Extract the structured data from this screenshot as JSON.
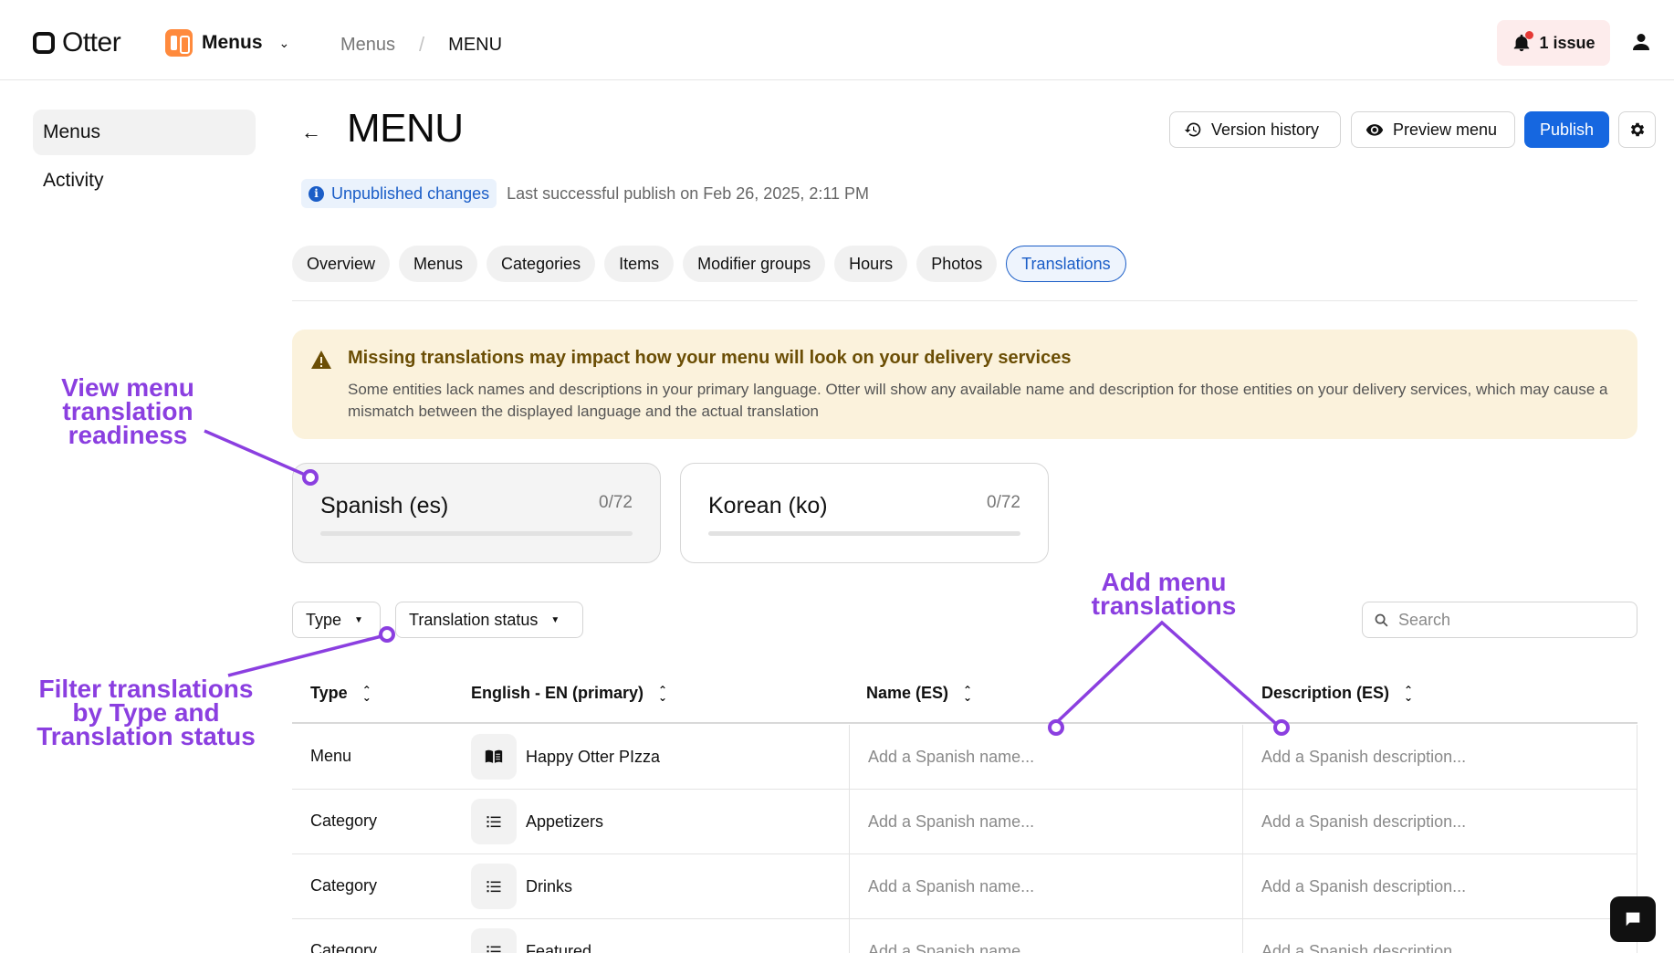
{
  "topbar": {
    "logo_text": "Otter",
    "app_name": "Menus",
    "breadcrumbs": [
      "Menus",
      "MENU"
    ],
    "breadcrumb_separator": "/",
    "issue_label": "1 issue"
  },
  "sidebar": {
    "items": [
      {
        "label": "Menus",
        "active": true
      },
      {
        "label": "Activity",
        "active": false
      }
    ]
  },
  "header": {
    "title": "MENU",
    "version_history_label": "Version history",
    "preview_label": "Preview menu",
    "publish_label": "Publish",
    "status_badge": "Unpublished changes",
    "status_text": "Last successful publish on Feb 26, 2025, 2:11 PM"
  },
  "tabs": [
    {
      "label": "Overview"
    },
    {
      "label": "Menus"
    },
    {
      "label": "Categories"
    },
    {
      "label": "Items"
    },
    {
      "label": "Modifier groups"
    },
    {
      "label": "Hours"
    },
    {
      "label": "Photos"
    },
    {
      "label": "Translations",
      "active": true
    }
  ],
  "warning": {
    "title": "Missing translations may impact how your menu will look on your delivery services",
    "body": "Some entities lack names and descriptions in your primary language. Otter will show any available name and description for those entities on your delivery services, which may cause a mismatch between the displayed language and the actual translation"
  },
  "languages": [
    {
      "name": "Spanish (es)",
      "count": "0/72",
      "progress": 0,
      "selected": true
    },
    {
      "name": "Korean (ko)",
      "count": "0/72",
      "progress": 0,
      "selected": false
    }
  ],
  "filters": {
    "type_label": "Type",
    "status_label": "Translation status",
    "search_placeholder": "Search"
  },
  "table": {
    "columns": [
      "Type",
      "English - EN (primary)",
      "Name (ES)",
      "Description (ES)"
    ],
    "name_placeholder": "Add a Spanish name...",
    "desc_placeholder": "Add a Spanish description...",
    "rows": [
      {
        "type": "Menu",
        "name": "Happy Otter PIzza",
        "icon": "menu-book-icon"
      },
      {
        "type": "Category",
        "name": "Appetizers",
        "icon": "list-icon"
      },
      {
        "type": "Category",
        "name": "Drinks",
        "icon": "list-icon"
      },
      {
        "type": "Category",
        "name": "Featured",
        "icon": "list-icon"
      }
    ]
  },
  "annotations": {
    "readiness": [
      "View menu",
      "translation",
      "readiness"
    ],
    "filter": [
      "Filter translations",
      "by Type and",
      "Translation status"
    ],
    "add": [
      "Add menu",
      "translations"
    ],
    "color": "#8b3fe0"
  },
  "colors": {
    "accent": "#1667e0",
    "warning_bg": "#fbf2dc",
    "annotation": "#8b3fe0"
  }
}
